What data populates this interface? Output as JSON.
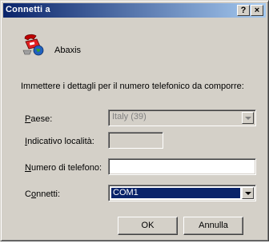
{
  "window": {
    "title": "Connetti a",
    "help_label": "?",
    "close_label": "×"
  },
  "connection": {
    "icon": "phone-connection-icon",
    "name": "Abaxis"
  },
  "instructions": "Immettere i dettagli per il numero telefonico da comporre:",
  "fields": {
    "country": {
      "mnemonic": "P",
      "label_rest": "aese:",
      "value": "Italy (39)",
      "enabled": false
    },
    "area_code": {
      "mnemonic": "I",
      "label_rest": "ndicativo località:",
      "value": "",
      "enabled": false
    },
    "phone_number": {
      "mnemonic": "N",
      "label_rest": "umero di telefono:",
      "value": "",
      "enabled": true
    },
    "connect_using": {
      "label_pre": "C",
      "mnemonic": "o",
      "label_rest": "nnetti:",
      "value": "COM1"
    }
  },
  "buttons": {
    "ok": "OK",
    "cancel": "Annulla"
  },
  "colors": {
    "title_gradient_start": "#0a246a",
    "title_gradient_end": "#a6caf0",
    "face": "#d4d0c8",
    "selection": "#0a246a"
  }
}
